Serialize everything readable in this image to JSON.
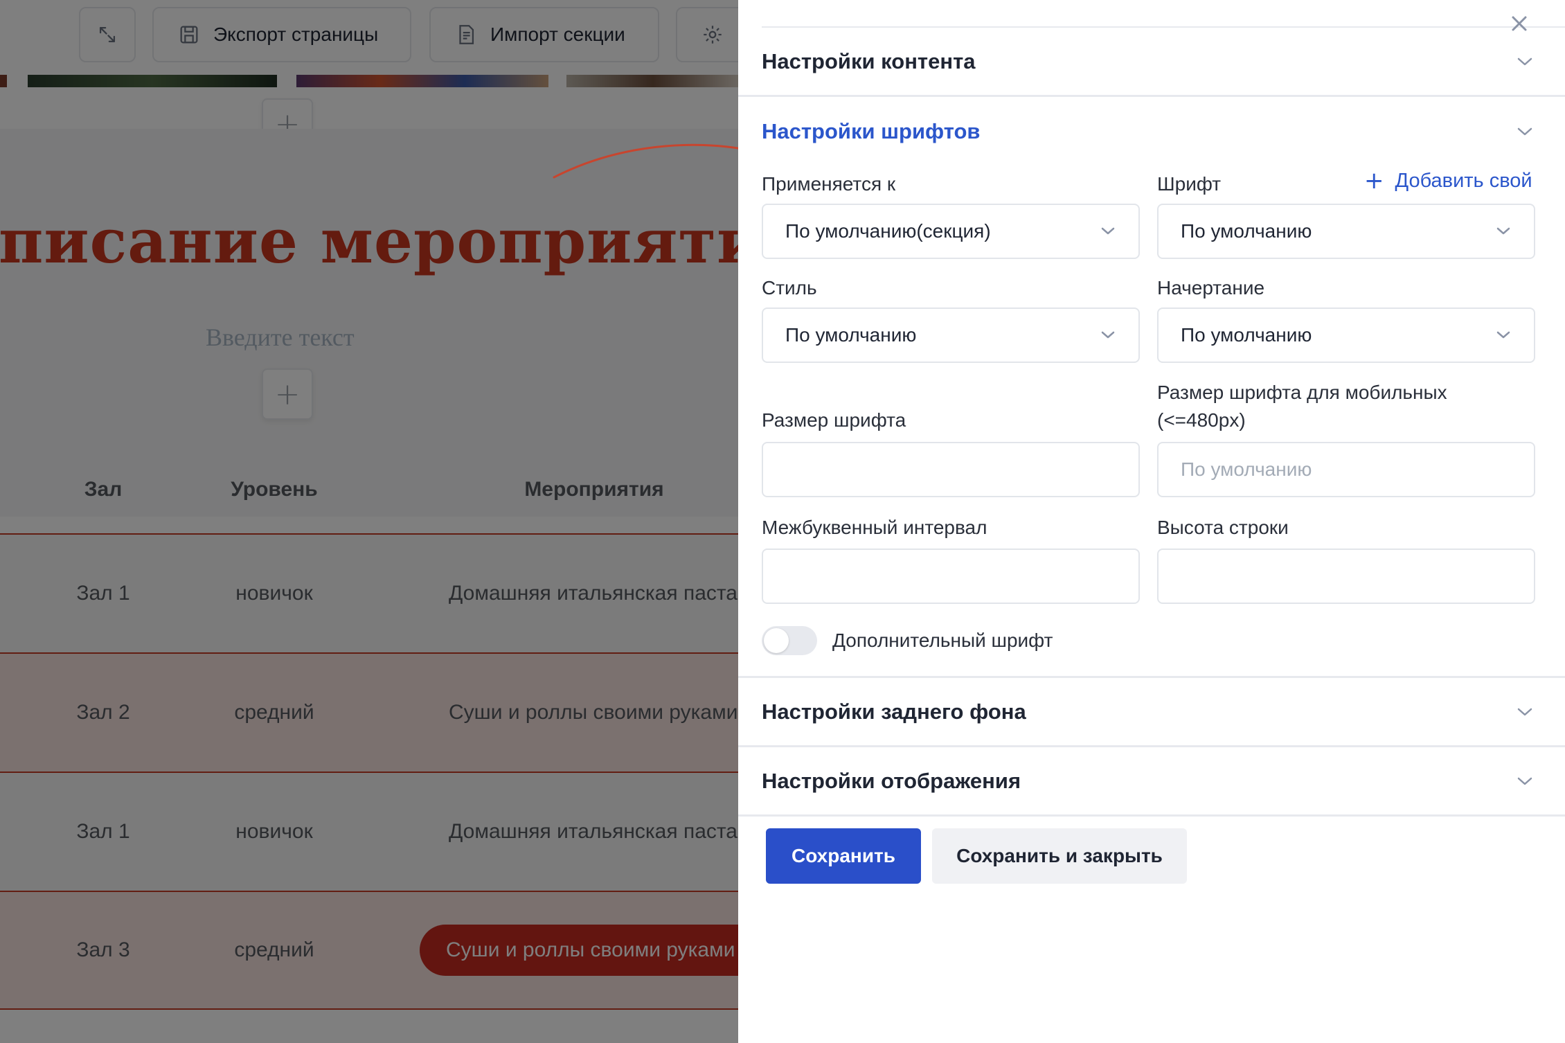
{
  "toolbar": {
    "export_label": "Экспорт страницы",
    "import_label": "Импорт секции",
    "settings_label": "Н"
  },
  "page": {
    "heading": "писание мероприятий",
    "subtext": "Введите текст",
    "table": {
      "headers": [
        "Зал",
        "Уровень",
        "Мероприятия"
      ],
      "rows": [
        {
          "hall": "Зал 1",
          "level": "новичок",
          "event": "Домашняя итальянская паста"
        },
        {
          "hall": "Зал 2",
          "level": "средний",
          "event": "Суши и роллы своими руками"
        },
        {
          "hall": "Зал 1",
          "level": "новичок",
          "event": "Домашняя итальянская паста"
        },
        {
          "hall": "Зал 3",
          "level": "средний",
          "event": "Суши и роллы своими руками"
        }
      ]
    }
  },
  "panel": {
    "sections": {
      "content": "Настройки контента",
      "fonts": "Настройки шрифтов",
      "background": "Настройки заднего фона",
      "display": "Настройки отображения"
    },
    "fonts": {
      "applies_to": {
        "label": "Применяется к",
        "value": "По умолчанию(секция)"
      },
      "font": {
        "label": "Шрифт",
        "value": "По умолчанию"
      },
      "add_own": "Добавить свой",
      "style": {
        "label": "Стиль",
        "value": "По умолчанию"
      },
      "weight": {
        "label": "Начертание",
        "value": "По умолчанию"
      },
      "font_size": {
        "label": "Размер шрифта",
        "value": ""
      },
      "mobile_font_size": {
        "label_line1": "Размер шрифта для мобильных",
        "label_line2": "(<=480px)",
        "placeholder": "По умолчанию"
      },
      "letter_spacing": {
        "label": "Межбуквенный интервал",
        "value": ""
      },
      "line_height": {
        "label": "Высота строки",
        "value": ""
      },
      "extra_font_toggle": {
        "label": "Дополнительный шрифт",
        "enabled": false
      }
    },
    "buttons": {
      "save": "Сохранить",
      "save_close": "Сохранить и закрыть"
    }
  },
  "colors": {
    "accent": "#2b56cb",
    "heading_red": "#c9371f",
    "pill_red": "#c72a20"
  }
}
